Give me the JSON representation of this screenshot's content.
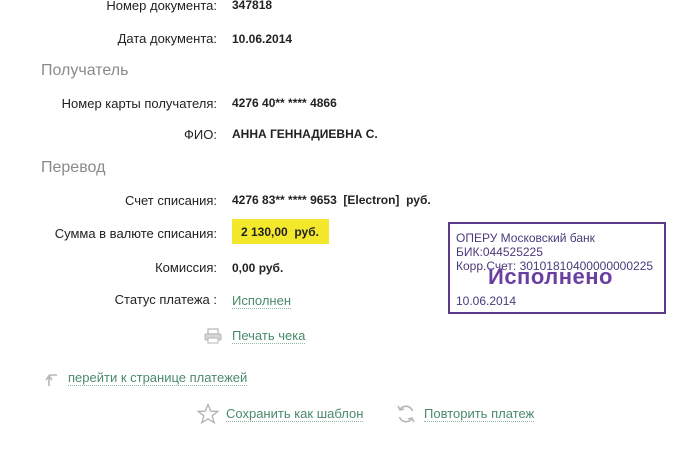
{
  "document": {
    "number_label": "Номер документа:",
    "number_value": "347818",
    "date_label": "Дата документа:",
    "date_value": "10.06.2014"
  },
  "recipient": {
    "section_title": "Получатель",
    "card_label": "Номер карты получателя:",
    "card_value": "4276 40** **** 4866",
    "name_label": "ФИО:",
    "name_value": "АННА ГЕННАДИЕВНА С."
  },
  "transfer": {
    "section_title": "Перевод",
    "account_label": "Счет списания:",
    "account_value": "4276 83** **** 9653  [Electron]  руб.",
    "amount_label": "Сумма в валюте списания:",
    "amount_value": "2 130,00  руб.",
    "fee_label": "Комиссия:",
    "fee_value": "0,00 руб.",
    "status_label": "Статус платежа :",
    "status_value": "Исполнен"
  },
  "stamp": {
    "line1": "ОПЕРУ Московский банк",
    "line2": "БИК:044525225",
    "line3": "Корр.Счет: 30101810400000000225",
    "status": "Исполнено",
    "date": "10.06.2014",
    "color": "#5b3a87"
  },
  "actions": {
    "print_label": "Печать чека",
    "back_label": "перейти к странице платежей",
    "save_template_label": "Сохранить как шаблон",
    "repeat_label": "Повторить платеж"
  },
  "colors": {
    "link": "#4a8a6a",
    "highlight": "#f3e82c",
    "section": "#8a8a8a"
  }
}
